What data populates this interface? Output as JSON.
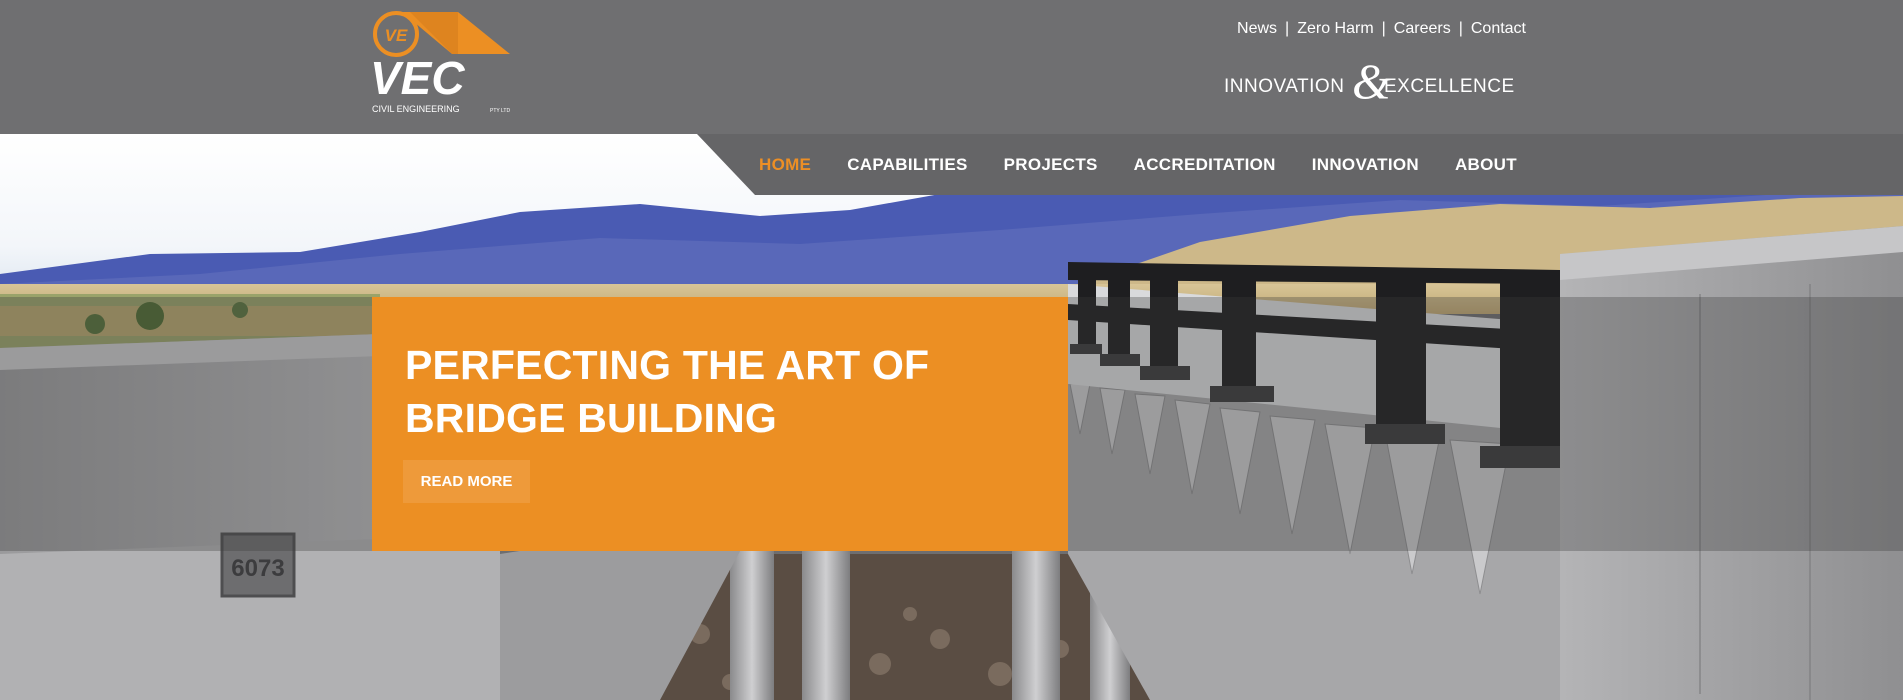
{
  "brand": {
    "name": "VEC",
    "subtitle": "CIVIL ENGINEERING",
    "subtitle_small": "PTY LTD",
    "monogram": "VE",
    "tagline_left": "INNOVATION",
    "tagline_amp": "&",
    "tagline_right": "EXCELLENCE",
    "colors": {
      "orange": "#ec8f23",
      "header_gray": "#6f6f71",
      "nav_gray": "#656567"
    }
  },
  "utility_nav": {
    "items": [
      {
        "label": "News"
      },
      {
        "label": "Zero Harm"
      },
      {
        "label": "Careers"
      },
      {
        "label": "Contact"
      }
    ],
    "separator": "|"
  },
  "main_nav": {
    "items": [
      {
        "label": "HOME",
        "active": true
      },
      {
        "label": "CAPABILITIES"
      },
      {
        "label": "PROJECTS"
      },
      {
        "label": "ACCREDITATION"
      },
      {
        "label": "INNOVATION"
      },
      {
        "label": "ABOUT"
      }
    ]
  },
  "hero": {
    "headline": "PERFECTING THE ART OF BRIDGE BUILDING",
    "cta_label": "READ MORE",
    "plaque_text": "6073"
  }
}
